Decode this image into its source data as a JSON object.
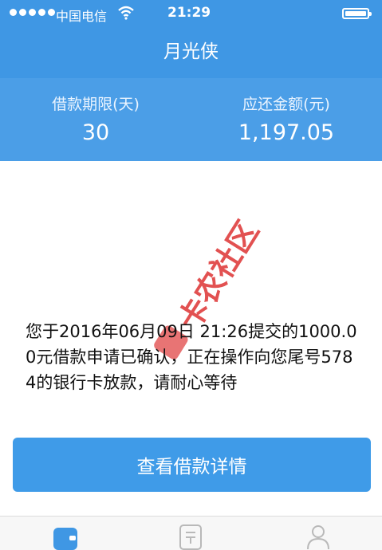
{
  "status_bar": {
    "carrier": "中国电信",
    "time": "21:29"
  },
  "header": {
    "title": "月光侠"
  },
  "summary": {
    "term_label": "借款期限(天)",
    "term_value": "30",
    "amount_label": "应还金额(元)",
    "amount_value": "1,197.05"
  },
  "watermark": {
    "text": "卡农社区"
  },
  "message": {
    "text": "您于2016年06月09日 21:26提交的1000.00元借款申请已确认，正在操作向您尾号5784的银行卡放款，请耐心等待"
  },
  "actions": {
    "details_label": "查看借款详情"
  },
  "tabbar": {
    "icons": [
      "wallet-icon",
      "bill-icon",
      "profile-icon"
    ]
  },
  "colors": {
    "primary": "#3f97e4",
    "summary_bg": "#4b9ee7",
    "button": "#3f9be8",
    "watermark": "#dd3333"
  }
}
